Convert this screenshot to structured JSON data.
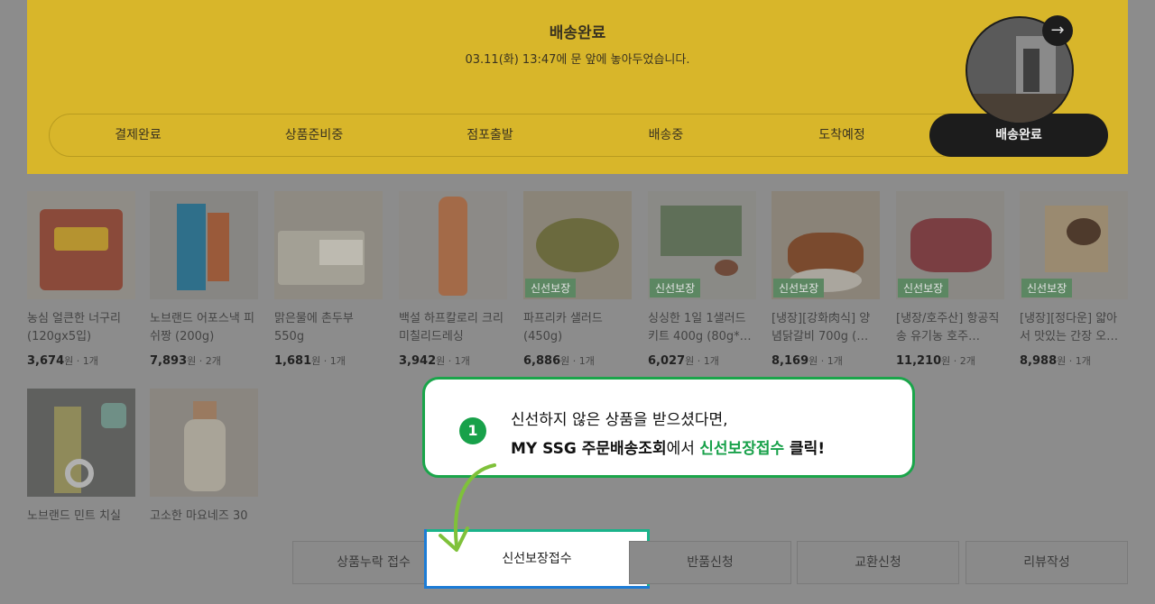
{
  "status": {
    "title": "배송완료",
    "subtitle": "03.11(화) 13:47에 문 앞에 놓아두었습니다."
  },
  "steps": [
    "결제완료",
    "상품준비중",
    "점포출발",
    "배송중",
    "도착예정",
    "배송완료"
  ],
  "products": [
    {
      "name": "농심 얼큰한 너구리 (120gx5입)",
      "price": "3,674",
      "unit": "원",
      "qty": "1개",
      "badge": ""
    },
    {
      "name": "노브랜드 어포스낵 피쉬짱 (200g)",
      "price": "7,893",
      "unit": "원",
      "qty": "2개",
      "badge": ""
    },
    {
      "name": "맑은물에 촌두부 550g",
      "price": "1,681",
      "unit": "원",
      "qty": "1개",
      "badge": ""
    },
    {
      "name": "백설 하프칼로리 크리미칠리드레싱",
      "price": "3,942",
      "unit": "원",
      "qty": "1개",
      "badge": ""
    },
    {
      "name": "파프리카 샐러드 (450g)",
      "price": "6,886",
      "unit": "원",
      "qty": "1개",
      "badge": "신선보장"
    },
    {
      "name": "싱싱한 1일 1샐러드 키트 400g (80g*…",
      "price": "6,027",
      "unit": "원",
      "qty": "1개",
      "badge": "신선보장"
    },
    {
      "name": "[냉장][강화肉식] 양념닭갈비 700g (…",
      "price": "8,169",
      "unit": "원",
      "qty": "1개",
      "badge": "신선보장"
    },
    {
      "name": "[냉장/호주산] 항공직송 유기농 호주…",
      "price": "11,210",
      "unit": "원",
      "qty": "2개",
      "badge": "신선보장"
    },
    {
      "name": "[냉장][정다운] 얇아서 맛있는 간장 오…",
      "price": "8,988",
      "unit": "원",
      "qty": "1개",
      "badge": "신선보장"
    },
    {
      "name": "노브랜드 민트 치실",
      "price": "",
      "unit": "",
      "qty": "",
      "badge": ""
    },
    {
      "name": "고소한 마요네즈 30",
      "price": "",
      "unit": "",
      "qty": "",
      "badge": ""
    }
  ],
  "actions": [
    "상품누락 접수",
    "신선보장접수",
    "반품신청",
    "교환신청",
    "리뷰작성"
  ],
  "tooltip": {
    "number": "1",
    "line1": "신선하지 않은 상품을 받으셨다면,",
    "line2_a": "MY SSG 주문배송조회",
    "line2_b": "에서 ",
    "line2_c": "신선보장접수",
    "line2_d": " 클릭!"
  },
  "icons": {
    "arrow": "arrow-right-icon"
  },
  "colors": {
    "accent_green": "#18a14a",
    "banner_yellow": "#d8b62a"
  }
}
